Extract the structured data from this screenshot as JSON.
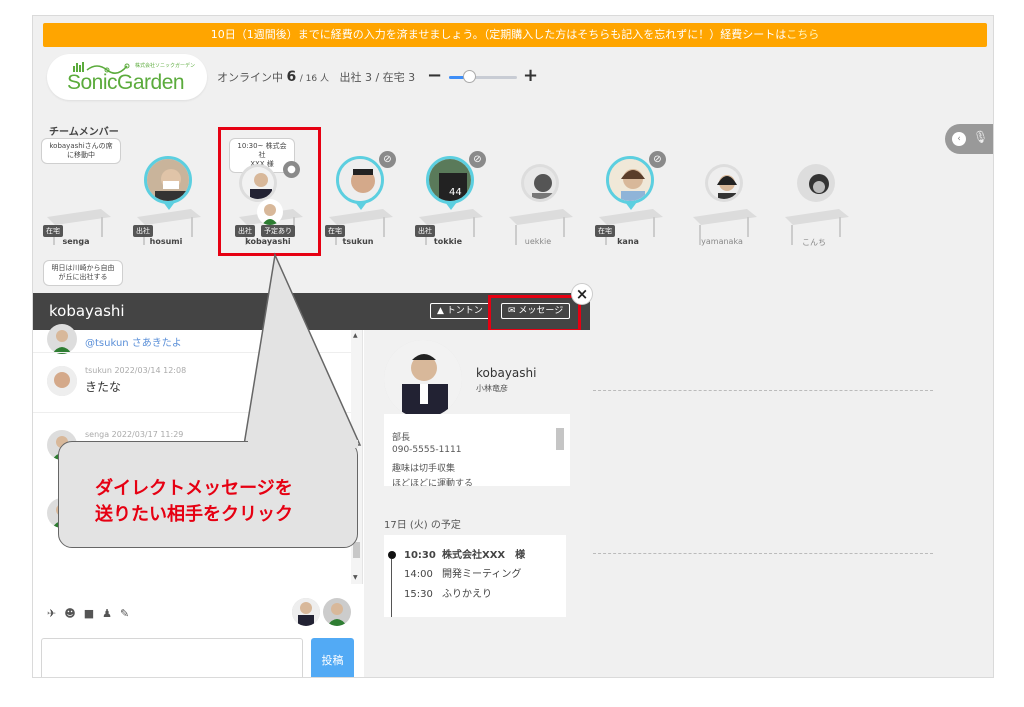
{
  "banner": {
    "text": "10日（1週間後）までに経費の入力を済ませましょう。（定期購入した方はそちらも記入を忘れずに！）経費シートは",
    "link": "こちら"
  },
  "logo": {
    "word": "SonicGarden",
    "sub": "株式会社ソニックガーデン"
  },
  "status": {
    "online_label": "オンライン中",
    "online_count": "6",
    "total": "/ 16 人",
    "office": "出社 3 /",
    "home": "在宅 3"
  },
  "zoom": {
    "minus": "−",
    "plus": "+",
    "level": 0.3
  },
  "team": {
    "label": "チームメンバー",
    "bubble_senga": "kobayashiさんの席\nに移動中",
    "bubble_kobayashi": "10:30~ 株式会社\nXXX 様",
    "bubble_next": "明日は川崎から自由\nが丘に出社する",
    "members": [
      {
        "name": "senga",
        "status": "在宅"
      },
      {
        "name": "hosumi",
        "status": "出社"
      },
      {
        "name": "kobayashi",
        "status": "出社",
        "status2": "予定あり"
      },
      {
        "name": "tsukun",
        "status": "在宅"
      },
      {
        "name": "tokkie",
        "status": "出社"
      },
      {
        "name": "uekkie",
        "status": ""
      },
      {
        "name": "kana",
        "status": "在宅"
      },
      {
        "name": "yamanaka",
        "status": ""
      },
      {
        "name": "こんち",
        "status": ""
      }
    ]
  },
  "panel": {
    "title": "kobayashi",
    "tonton": "トントン",
    "message": "メッセージ",
    "close": "×",
    "messages": [
      {
        "meta": "@tsukun さあきたよ",
        "text": ""
      },
      {
        "meta": "tsukun  2022/03/14 12:08",
        "text": "きたな"
      },
      {
        "meta": "senga  2022/03/17 11:29",
        "text": ""
      }
    ],
    "post": "投稿"
  },
  "profile": {
    "name": "kobayashi",
    "jname": "小林竜彦",
    "info": [
      "部長",
      "090-5555-1111",
      "趣味は切手収集",
      "ほどほどに運動する"
    ],
    "schedule_title": "17日 (火) の予定",
    "schedule": [
      {
        "time": "10:30",
        "title": "株式会社XXX　様"
      },
      {
        "time": "14:00",
        "title": "開発ミーティング"
      },
      {
        "time": "15:30",
        "title": "ふりかえり"
      }
    ]
  },
  "callout": {
    "line1": "ダイレクトメッセージを",
    "line2": "送りたい相手をクリック"
  },
  "colors": {
    "accent": "#e60012",
    "banner": "#ffa500",
    "avatar_ring": "#5ccfe0",
    "post": "#52aaf5"
  }
}
